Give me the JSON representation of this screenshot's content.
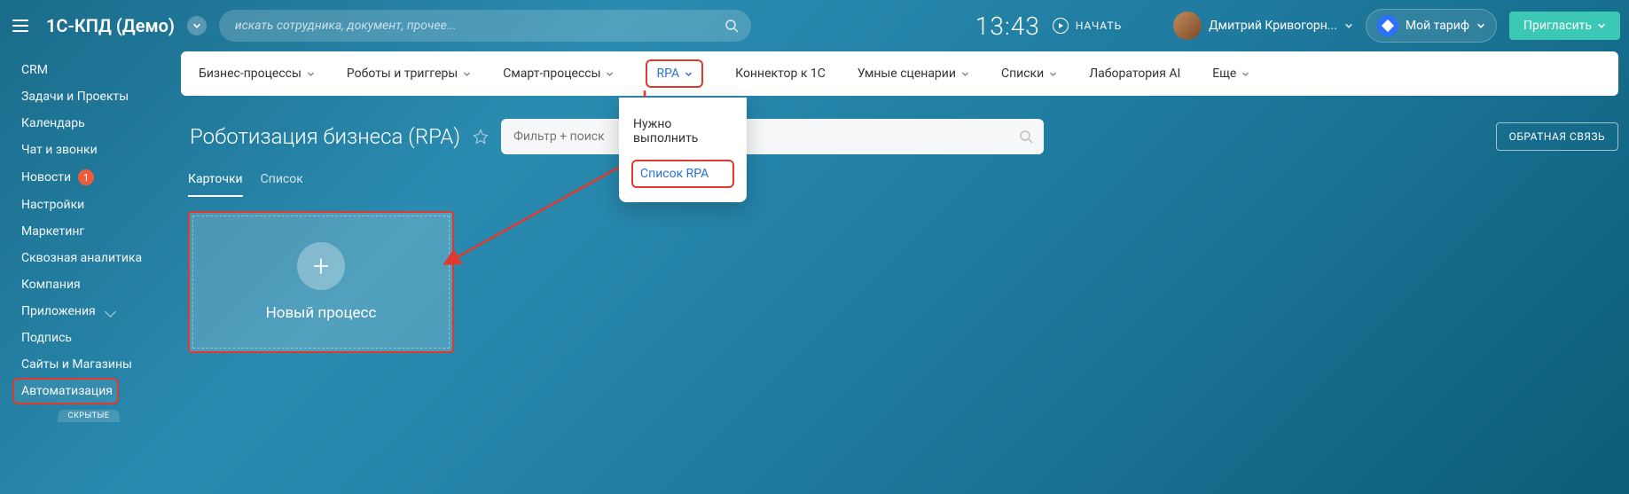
{
  "annotation_color": "#e03a2f",
  "topbar": {
    "logo": "1С-КПД (Демо)",
    "search_placeholder": "искать сотрудника, документ, прочее...",
    "clock": "13:43",
    "start_label": "НАЧАТЬ",
    "user_name": "Дмитрий Кривогорн...",
    "tarif_label": "Мой тариф",
    "invite_label": "Пригласить"
  },
  "sidebar": {
    "items": [
      {
        "label": "CRM"
      },
      {
        "label": "Задачи и Проекты"
      },
      {
        "label": "Календарь"
      },
      {
        "label": "Чат и звонки"
      },
      {
        "label": "Новости",
        "badge": "1"
      },
      {
        "label": "Настройки"
      },
      {
        "label": "Маркетинг"
      },
      {
        "label": "Сквозная аналитика"
      },
      {
        "label": "Компания"
      },
      {
        "label": "Приложения",
        "arrow": true
      },
      {
        "label": "Подпись"
      },
      {
        "label": "Сайты и Магазины"
      },
      {
        "label": "Автоматизация",
        "highlight": true
      }
    ],
    "hidden_label": "СКРЫТЫЕ"
  },
  "tabs": [
    {
      "label": "Бизнес-процессы",
      "arrow": true
    },
    {
      "label": "Роботы и триггеры",
      "arrow": true
    },
    {
      "label": "Смарт-процессы",
      "arrow": true
    },
    {
      "label": "RPA",
      "arrow": true,
      "highlight": true
    },
    {
      "label": "Коннектор к 1С"
    },
    {
      "label": "Умные сценарии",
      "arrow": true
    },
    {
      "label": "Списки",
      "arrow": true
    },
    {
      "label": "Лаборатория AI"
    },
    {
      "label": "Еще",
      "arrow": true
    }
  ],
  "dropdown": {
    "items": [
      {
        "label": "Нужно выполнить"
      },
      {
        "label": "Список RPA",
        "highlight": true
      }
    ]
  },
  "page": {
    "title": "Роботизация бизнеса (RPA)",
    "filter_placeholder": "Фильтр + поиск",
    "feedback_label": "ОБРАТНАЯ СВЯЗЬ"
  },
  "view_tabs": [
    {
      "label": "Карточки",
      "active": true
    },
    {
      "label": "Список"
    }
  ],
  "card": {
    "label": "Новый процесс"
  }
}
